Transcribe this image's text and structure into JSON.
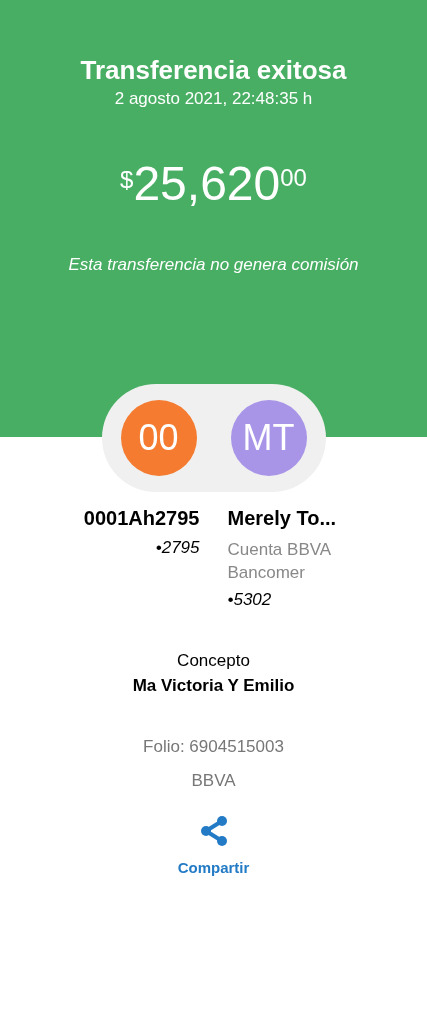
{
  "header": {
    "title": "Transferencia exitosa",
    "datetime": "2 agosto 2021, 22:48:35 h",
    "amount": {
      "currency": "$",
      "integer": "25,620",
      "cents": "00"
    },
    "note": "Esta transferencia no genera comisión"
  },
  "parties": [
    {
      "initials": "00",
      "color": "#f47b2f",
      "name": "0001Ah2795",
      "account": "•2795"
    },
    {
      "initials": "MT",
      "color": "#a895e8",
      "name": "Merely To...",
      "lines": [
        "Cuenta BBVA",
        "Bancomer"
      ],
      "account": "•5302"
    }
  ],
  "concept": {
    "label": "Concepto",
    "value": "Ma Victoria Y Emilio"
  },
  "folio": "Folio: 6904515003",
  "bank": "BBVA",
  "share": {
    "label": "Compartir"
  }
}
